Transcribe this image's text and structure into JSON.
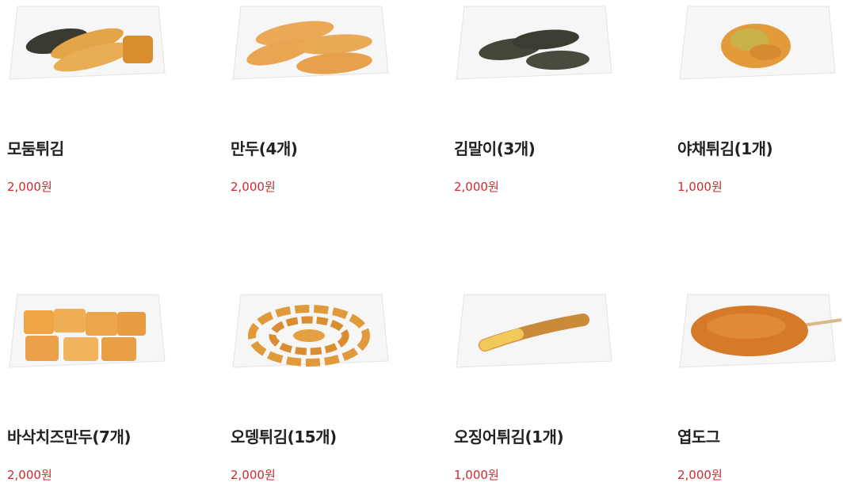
{
  "menu": {
    "items": [
      {
        "name": "모둠튀김",
        "price": "2,000원"
      },
      {
        "name": "만두(4개)",
        "price": "2,000원"
      },
      {
        "name": "김말이(3개)",
        "price": "2,000원"
      },
      {
        "name": "야채튀김(1개)",
        "price": "1,000원"
      },
      {
        "name": "바삭치즈만두(7개)",
        "price": "2,000원"
      },
      {
        "name": "오뎅튀김(15개)",
        "price": "2,000원"
      },
      {
        "name": "오징어튀김(1개)",
        "price": "1,000원"
      },
      {
        "name": "엽도그",
        "price": "2,000원"
      }
    ]
  },
  "colors": {
    "price": "#d0282e",
    "name": "#222222",
    "fried": "#e8a23c",
    "plate": "#f4f4f4"
  }
}
